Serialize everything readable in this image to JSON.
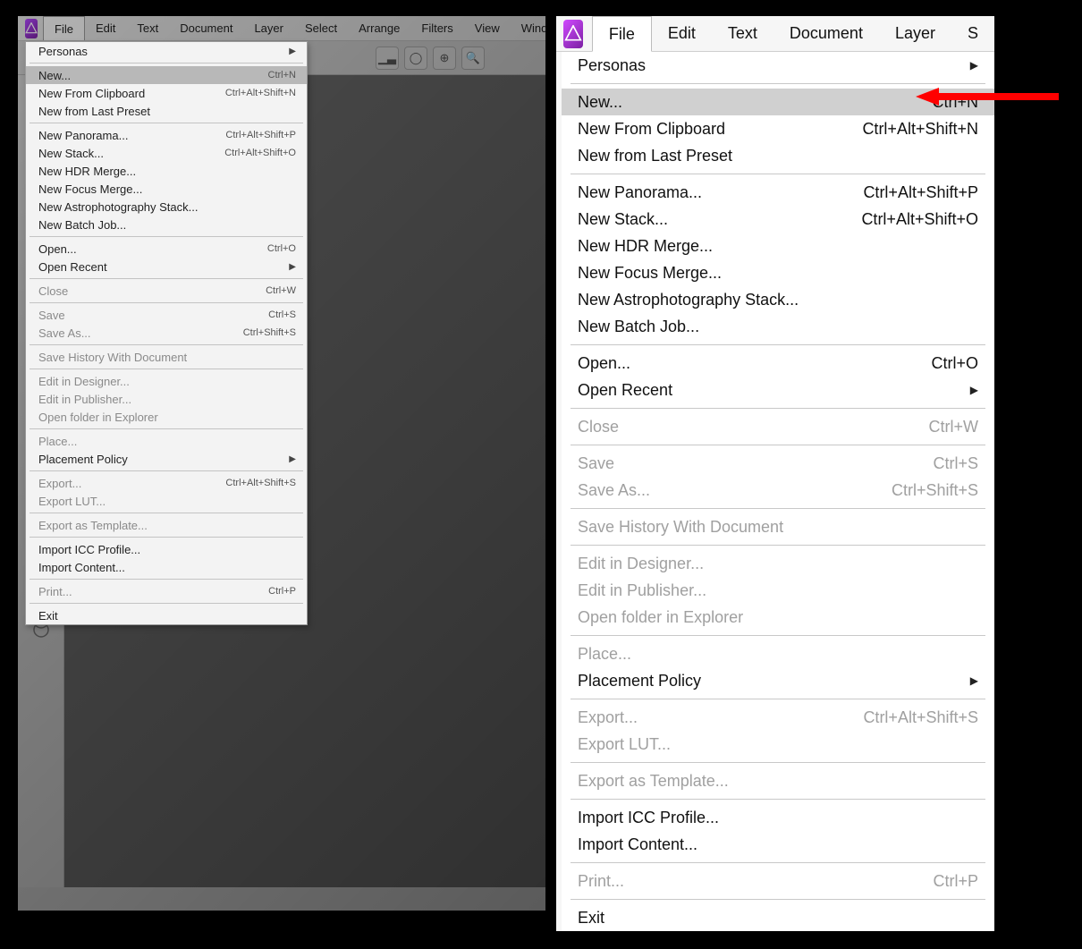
{
  "menubar": {
    "items": [
      "File",
      "Edit",
      "Text",
      "Document",
      "Layer",
      "Select",
      "Arrange",
      "Filters",
      "View",
      "Window"
    ],
    "items_right": [
      "File",
      "Edit",
      "Text",
      "Document",
      "Layer",
      "S"
    ]
  },
  "menu": {
    "groups": [
      [
        {
          "label": "Personas",
          "submenu": true
        }
      ],
      [
        {
          "label": "New...",
          "shortcut": "Ctrl+N",
          "highlighted": true
        },
        {
          "label": "New From Clipboard",
          "shortcut": "Ctrl+Alt+Shift+N"
        },
        {
          "label": "New from Last Preset"
        }
      ],
      [
        {
          "label": "New Panorama...",
          "shortcut": "Ctrl+Alt+Shift+P"
        },
        {
          "label": "New Stack...",
          "shortcut": "Ctrl+Alt+Shift+O"
        },
        {
          "label": "New HDR Merge..."
        },
        {
          "label": "New Focus Merge..."
        },
        {
          "label": "New Astrophotography Stack..."
        },
        {
          "label": "New Batch Job..."
        }
      ],
      [
        {
          "label": "Open...",
          "shortcut": "Ctrl+O"
        },
        {
          "label": "Open Recent",
          "submenu": true
        }
      ],
      [
        {
          "label": "Close",
          "shortcut": "Ctrl+W",
          "disabled": true
        }
      ],
      [
        {
          "label": "Save",
          "shortcut": "Ctrl+S",
          "disabled": true
        },
        {
          "label": "Save As...",
          "shortcut": "Ctrl+Shift+S",
          "disabled": true
        }
      ],
      [
        {
          "label": "Save History With Document",
          "disabled": true
        }
      ],
      [
        {
          "label": "Edit in Designer...",
          "disabled": true
        },
        {
          "label": "Edit in Publisher...",
          "disabled": true
        },
        {
          "label": "Open folder in Explorer",
          "disabled": true
        }
      ],
      [
        {
          "label": "Place...",
          "disabled": true
        },
        {
          "label": "Placement Policy",
          "submenu": true
        }
      ],
      [
        {
          "label": "Export...",
          "shortcut": "Ctrl+Alt+Shift+S",
          "disabled": true
        },
        {
          "label": "Export LUT...",
          "disabled": true
        }
      ],
      [
        {
          "label": "Export as Template...",
          "disabled": true
        }
      ],
      [
        {
          "label": "Import ICC Profile..."
        },
        {
          "label": "Import Content..."
        }
      ],
      [
        {
          "label": "Print...",
          "shortcut": "Ctrl+P",
          "disabled": true
        }
      ],
      [
        {
          "label": "Exit"
        }
      ]
    ]
  }
}
